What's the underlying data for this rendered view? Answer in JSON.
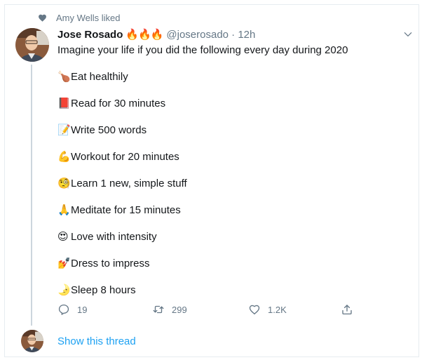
{
  "social_context": {
    "text": "Amy Wells liked"
  },
  "tweet": {
    "author_name": "Jose Rosado",
    "author_emoji": "🔥🔥🔥",
    "handle_time": "@joserosado · 12h",
    "intro": "Imagine your life if you did the following every day during 2020",
    "items": [
      {
        "emoji": "🍗",
        "text": "Eat healthily"
      },
      {
        "emoji": "📕",
        "text": "Read for 30 minutes"
      },
      {
        "emoji": "📝",
        "text": "Write 500 words"
      },
      {
        "emoji": "💪",
        "text": "Workout for 20 minutes"
      },
      {
        "emoji": "🧐",
        "text": "Learn 1 new, simple stuff"
      },
      {
        "emoji": "🙏",
        "text": " Meditate for 15 minutes"
      },
      {
        "emoji": "😍",
        "text": "Love with intensity"
      },
      {
        "emoji": "💅",
        "text": "Dress to impress"
      },
      {
        "emoji": "🌛",
        "text": "Sleep 8 hours"
      }
    ],
    "actions": {
      "reply_count": "19",
      "retweet_count": "299",
      "like_count": "1.2K"
    }
  },
  "show_thread_label": "Show this thread",
  "colors": {
    "link": "#1da1f2",
    "muted": "#657786",
    "thread_line": "#ccd6dd"
  },
  "icons": [
    "heart-icon",
    "chevron-down-icon",
    "reply-icon",
    "retweet-icon",
    "like-icon",
    "share-icon"
  ]
}
